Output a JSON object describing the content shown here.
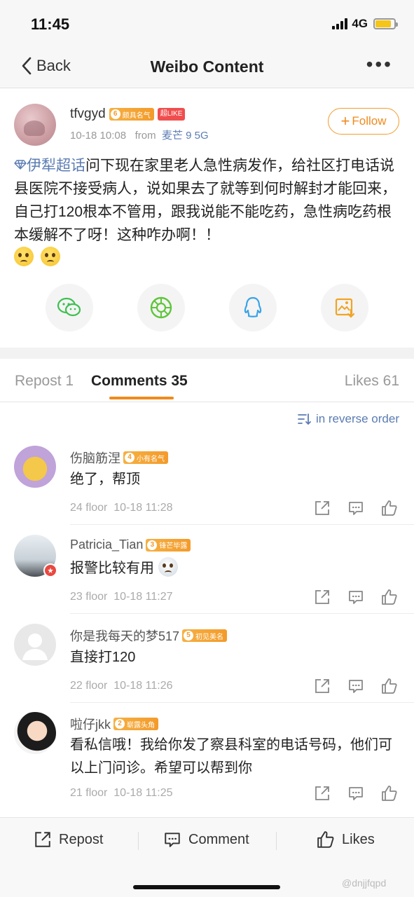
{
  "status_bar": {
    "time": "11:45",
    "network": "4G"
  },
  "nav": {
    "back_label": "Back",
    "title": "Weibo Content"
  },
  "post": {
    "username": "tfvgyd",
    "level_num": "6",
    "level_text": "颇具名气",
    "super_badge": "超LIKE",
    "time": "10-18 10:08",
    "from_label": "from",
    "source": "麦芒 9 5G",
    "follow_label": "Follow",
    "topic": "伊犁超话",
    "text": "问下现在家里老人急性病发作，给社区打电话说县医院不接受病人，说如果去了就等到何时解封才能回来，自己打120根本不管用，跟我说能不能吃药，急性病吃药根本缓解不了呀！这种咋办啊！！"
  },
  "share_icons": [
    "wechat-icon",
    "moments-icon",
    "qq-icon",
    "save-image-icon"
  ],
  "tabs": {
    "repost": "Repost 1",
    "comments": "Comments 35",
    "likes": "Likes 61"
  },
  "order_label": "in reverse order",
  "comments": [
    {
      "name": "伤脑筋涅",
      "level_num": "4",
      "level_text": "小有名气",
      "text": "绝了，帮顶",
      "floor": "24 floor",
      "time": "10-18 11:28"
    },
    {
      "name": "Patricia_Tian",
      "level_num": "3",
      "level_text": "锋芒毕露",
      "text": "报警比较有用",
      "floor": "23 floor",
      "time": "10-18 11:27"
    },
    {
      "name": "你是我每天的梦517",
      "level_num": "5",
      "level_text": "初见美名",
      "text": "直接打120",
      "floor": "22 floor",
      "time": "10-18 11:26"
    },
    {
      "name": "啦仔jkk",
      "level_num": "2",
      "level_text": "崭露头角",
      "text": "看私信哦！我给你发了察县科室的电话号码，他们可以上门问诊。希望可以帮到你",
      "floor": "21 floor",
      "time": "10-18 11:25"
    }
  ],
  "bottom_bar": {
    "repost": "Repost",
    "comment": "Comment",
    "likes": "Likes"
  },
  "watermark": "@dnjjfqpd",
  "colors": {
    "accent": "#f08a1c",
    "link": "#5b7cb3",
    "battery": "#f5c518"
  }
}
